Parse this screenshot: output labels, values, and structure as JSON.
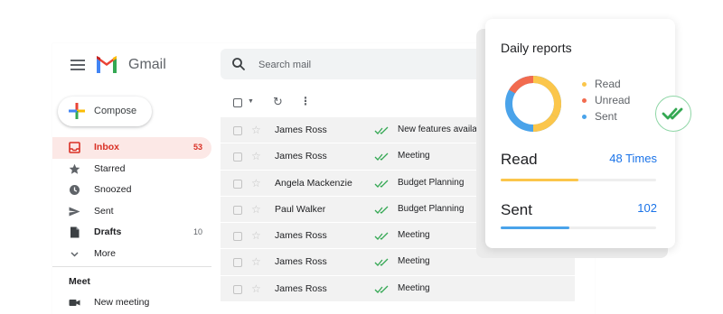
{
  "app": {
    "title": "Gmail"
  },
  "search": {
    "placeholder": "Search mail"
  },
  "compose": {
    "label": "Compose"
  },
  "nav": {
    "items": [
      {
        "label": "Inbox",
        "count": "53",
        "icon": "inbox-icon"
      },
      {
        "label": "Starred",
        "count": "",
        "icon": "star-icon"
      },
      {
        "label": "Snoozed",
        "count": "",
        "icon": "clock-icon"
      },
      {
        "label": "Sent",
        "count": "",
        "icon": "send-icon"
      },
      {
        "label": "Drafts",
        "count": "10",
        "icon": "draft-icon"
      },
      {
        "label": "More",
        "count": "",
        "icon": "chevron-down-icon"
      }
    ]
  },
  "meet": {
    "title": "Meet",
    "new_meeting": "New meeting"
  },
  "emails": [
    {
      "sender": "James Ross",
      "subject": "New features available"
    },
    {
      "sender": "James Ross",
      "subject": "Meeting"
    },
    {
      "sender": "Angela Mackenzie",
      "subject": "Budget Planning"
    },
    {
      "sender": "Paul Walker",
      "subject": "Budget Planning"
    },
    {
      "sender": "James Ross",
      "subject": "Meeting"
    },
    {
      "sender": "James Ross",
      "subject": "Meeting"
    },
    {
      "sender": "James Ross",
      "subject": "Meeting"
    }
  ],
  "report": {
    "title": "Daily reports",
    "legend": [
      "Read",
      "Unread",
      "Sent"
    ],
    "read_label": "Read",
    "read_value": "48 Times",
    "read_progress": 0.5,
    "sent_label": "Sent",
    "sent_value": "102",
    "sent_progress": 0.44
  },
  "colors": {
    "read": "#fbc64b",
    "unread": "#f26b4f",
    "sent": "#4aa3ea",
    "accent_red": "#d93025",
    "link_blue": "#1a73e8",
    "check_green": "#34a853"
  }
}
